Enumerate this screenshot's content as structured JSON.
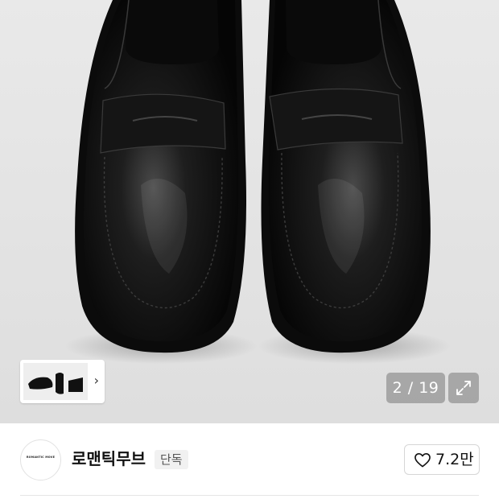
{
  "gallery": {
    "current": "2",
    "separator": "/",
    "total": "19",
    "counter_text": "2 / 19",
    "thumbnail_chevron": "›"
  },
  "brand": {
    "logo_text": "ROMANTIC MOVE",
    "name": "로맨틱무브",
    "badge": "단독"
  },
  "like": {
    "icon": "heart-icon",
    "count": "7.2만"
  },
  "colors": {
    "hero_bg": "#e5e5e5",
    "overlay": "rgba(120,120,120,0.55)",
    "badge_bg": "#f1f1f1"
  }
}
